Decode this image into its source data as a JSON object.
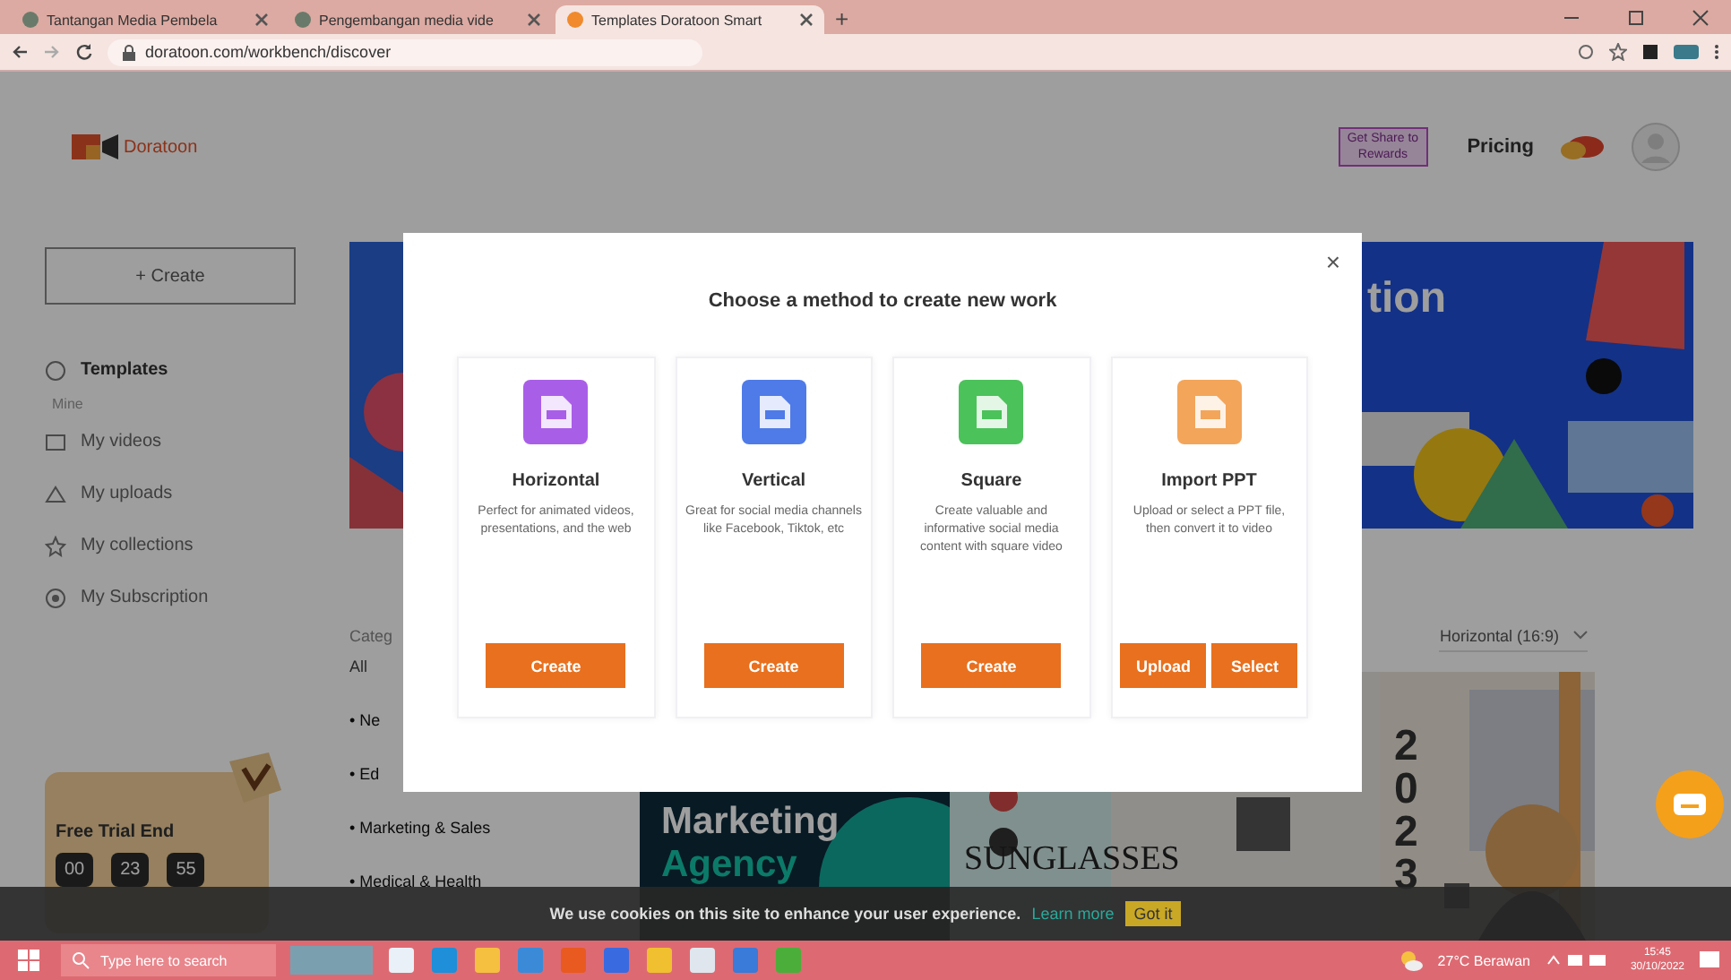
{
  "browser": {
    "tabs": [
      {
        "title": "Tantangan Media Pembela",
        "selected": false
      },
      {
        "title": "Pengembangan media vide",
        "selected": false
      },
      {
        "title": "Templates Doratoon Smart",
        "selected": true
      }
    ],
    "new_tab": "+",
    "url": "doratoon.com/workbench/discover"
  },
  "header": {
    "logo": "Doratoon",
    "promo": "Get Share to Rewards",
    "pricing": "Pricing"
  },
  "sidebar": {
    "create": "+ Create",
    "items": [
      {
        "kind": "link",
        "label": "Templates",
        "selected": true
      },
      {
        "kind": "heading",
        "label": "Mine"
      },
      {
        "kind": "link",
        "label": "My videos",
        "selected": false
      },
      {
        "kind": "link",
        "label": "My uploads",
        "selected": false
      },
      {
        "kind": "link",
        "label": "My collections",
        "selected": false
      },
      {
        "kind": "link",
        "label": "My Subscription",
        "selected": false
      }
    ],
    "trial": {
      "title": "Free Trial End",
      "counters": [
        "00",
        "23",
        "55"
      ]
    }
  },
  "main": {
    "banner_text": "tion",
    "category_label": "Categ",
    "filter": "Horizontal (16:9)",
    "categories": [
      "All",
      "• Ne",
      "• Ed",
      "• Marketing & Sales",
      "• Medical & Health"
    ],
    "templates": [
      {
        "kind": "text",
        "title": "Marketing",
        "subtitle": "Agency"
      },
      {
        "caption": "SUNGLASSES"
      },
      {
        "kind": "poster",
        "caption": "2023"
      }
    ]
  },
  "modal": {
    "title": "Choose a method to create new work",
    "close": "×",
    "options": [
      {
        "title": "Horizontal",
        "description": "Perfect for animated videos, presentations, and the web",
        "color": "#a95ee8",
        "buttons": [
          "Create"
        ]
      },
      {
        "title": "Vertical",
        "description": "Great for social media channels like Facebook, Tiktok, etc",
        "color": "#4f7be8",
        "buttons": [
          "Create"
        ]
      },
      {
        "title": "Square",
        "description": "Create valuable and informative social media content with square video",
        "color": "#4cc25a",
        "buttons": [
          "Create"
        ]
      },
      {
        "title": "Import PPT",
        "description": "Upload or select a PPT file, then convert it to video",
        "color": "#f3a55a",
        "buttons": [
          "Upload",
          "Select"
        ]
      }
    ]
  },
  "cookie": {
    "text": "We use cookies on this site to enhance your user experience.",
    "link": "Learn more",
    "button": "Got it"
  },
  "taskbar": {
    "search": "Type here to search",
    "weather": "27°C Berawan",
    "time": "15:45",
    "date": "30/10/2022"
  }
}
